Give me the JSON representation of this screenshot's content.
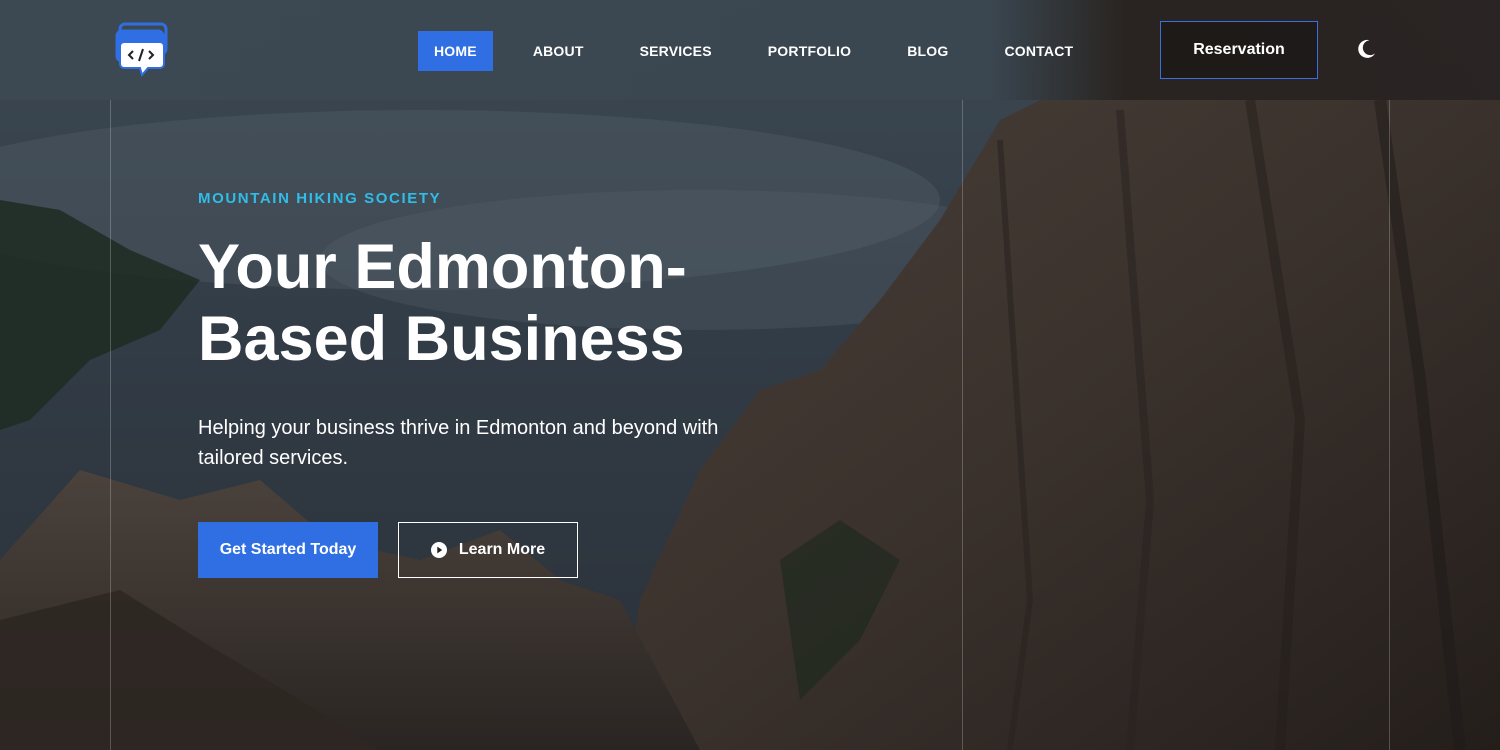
{
  "header": {
    "logo_icon": "code-chat-icon",
    "nav": [
      {
        "label": "HOME",
        "active": true
      },
      {
        "label": "ABOUT",
        "active": false
      },
      {
        "label": "SERVICES",
        "active": false
      },
      {
        "label": "PORTFOLIO",
        "active": false
      },
      {
        "label": "BLOG",
        "active": false
      },
      {
        "label": "CONTACT",
        "active": false
      }
    ],
    "reservation_label": "Reservation",
    "theme_toggle_icon": "moon-icon"
  },
  "hero": {
    "eyebrow": "MOUNTAIN HIKING SOCIETY",
    "headline": "Your Edmonton-Based Business",
    "subtext": "Helping your business thrive in Edmonton and beyond with tailored services.",
    "primary_cta": "Get Started Today",
    "secondary_cta": "Learn More",
    "secondary_cta_icon": "play-circle-icon"
  },
  "colors": {
    "accent": "#2f6fe3",
    "eyebrow": "#30bde8",
    "text": "#ffffff"
  }
}
